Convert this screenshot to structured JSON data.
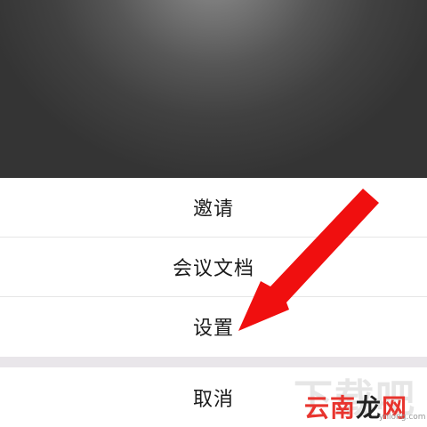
{
  "action_sheet": {
    "items": [
      {
        "label": "邀请"
      },
      {
        "label": "会议文档"
      },
      {
        "label": "设置"
      }
    ],
    "cancel_label": "取消"
  },
  "annotation": {
    "arrow_color": "#f00f0f"
  },
  "watermark": {
    "large_text": "下载吧",
    "site_red": "云南",
    "site_dark": "龙",
    "site_red_2": "网",
    "domain": "ynlong.com"
  },
  "colors": {
    "sheet_background": "#ffffff",
    "divider": "#e6e6e6",
    "gap": "#e9e6ea",
    "text": "#1a1a1a"
  }
}
